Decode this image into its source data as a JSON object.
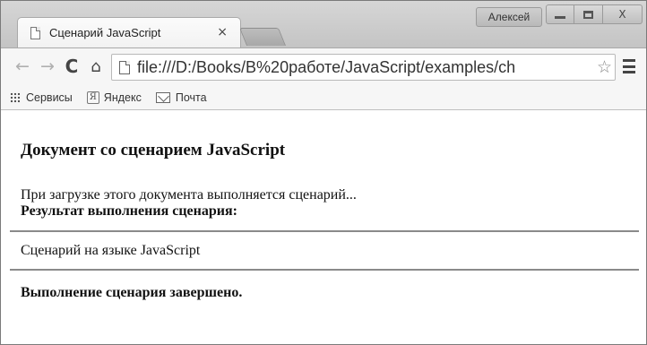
{
  "browser": {
    "tab": {
      "title": "Сценарий JavaScript",
      "close_glyph": "×"
    },
    "user_name": "Алексей",
    "address": {
      "url": "file:///D:/Books/В%20работе/JavaScript/examples/ch"
    },
    "nav": {
      "back": "←",
      "forward": "→",
      "reload": "C",
      "home": "⌂"
    },
    "star_glyph": "☆",
    "window_close_glyph": "X"
  },
  "bookmarks": [
    {
      "label": "Сервисы",
      "icon": "apps-icon"
    },
    {
      "label": "Яндекс",
      "icon": "yandex-icon",
      "icon_glyph": "Я"
    },
    {
      "label": "Почта",
      "icon": "mail-icon"
    }
  ],
  "page": {
    "heading": "Документ со сценарием JavaScript",
    "intro": "При загрузке этого документа выполняется сценарий...",
    "result_label": "Результат выполнения сценария:",
    "script_output": "Сценарий на языке JavaScript",
    "done": "Выполнение сценария завершено."
  }
}
